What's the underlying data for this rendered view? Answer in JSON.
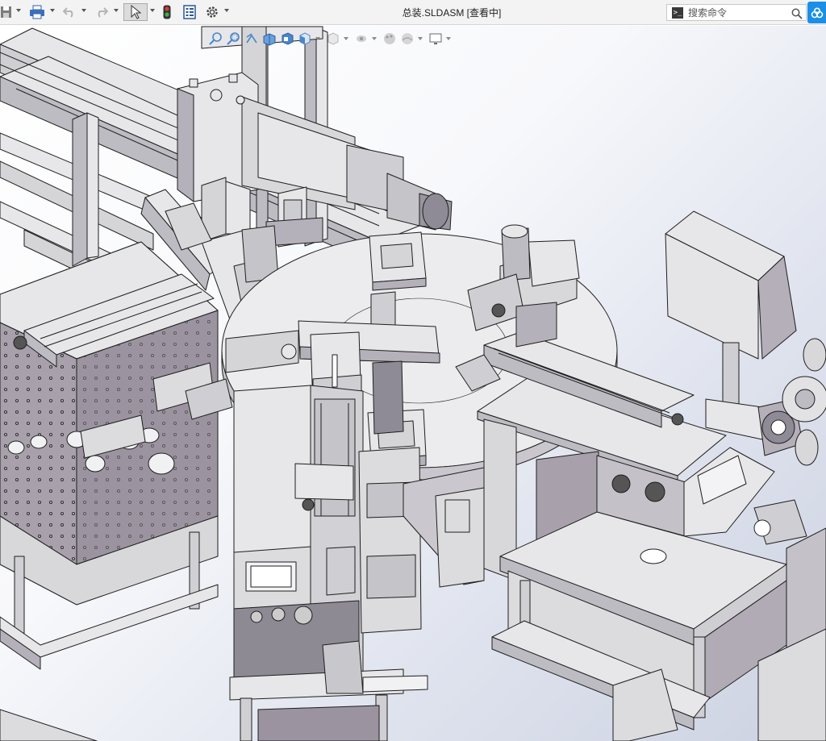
{
  "window": {
    "title": "总装.SLDASM [查看中]"
  },
  "quick_access": {
    "items": [
      "save-icon",
      "print-icon",
      "undo-icon",
      "redo-icon",
      "select-icon",
      "rebuild-icon",
      "file-properties-icon",
      "options-icon"
    ]
  },
  "search": {
    "placeholder": "搜索命令"
  },
  "heads_up_toolbar": {
    "items": [
      "zoom-to-fit-icon",
      "zoom-to-area-icon",
      "previous-view-icon",
      "section-view-icon",
      "dynamic-annotation-icon",
      "view-orientation-icon",
      "display-style-icon",
      "hide-show-items-icon",
      "edit-appearance-icon",
      "apply-scene-icon",
      "view-settings-icon"
    ]
  },
  "colors": {
    "viewport_bg_light": "#ffffff",
    "viewport_bg_dark": "#cdd2e2",
    "part_fill": "#e6e6e8",
    "part_shadow": "#a9a2ad",
    "part_edge": "#1e1e1e",
    "accent_blue": "#1a8fe8"
  }
}
